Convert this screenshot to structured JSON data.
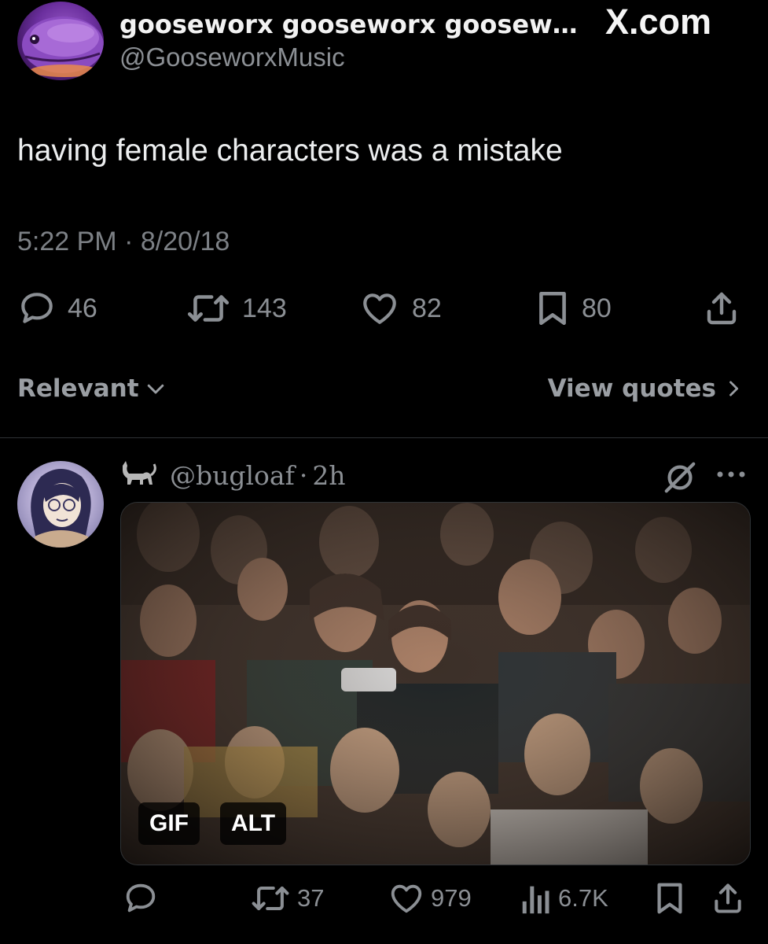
{
  "post": {
    "author_name": "gooseworx gooseworx goosewo...",
    "author_handle": "@GooseworxMusic",
    "site": "X.com",
    "text": "having female characters was a mistake",
    "timestamp": "5:22 PM · 8/20/18",
    "stats": {
      "replies": "46",
      "reposts": "143",
      "likes": "82",
      "bookmarks": "80"
    },
    "sort_label": "Relevant",
    "view_quotes_label": "View quotes"
  },
  "reply": {
    "handle": "@bugloaf",
    "separator": "·",
    "time": "2h",
    "media_badges": {
      "gif": "GIF",
      "alt": "ALT"
    },
    "stats": {
      "replies": "",
      "reposts": "37",
      "likes": "979",
      "views": "6.7K"
    }
  },
  "icons": {
    "reply": "speech-bubble-icon",
    "repost": "repost-arrows-icon",
    "like": "heart-icon",
    "bookmark": "bookmark-icon",
    "share": "share-upload-icon",
    "views": "bar-chart-icon",
    "grok": "grok-slash-icon",
    "more": "more-dots-icon",
    "cat": "cat-emoji-icon",
    "chevron_down": "chevron-down-icon",
    "chevron_right": "chevron-right-icon"
  },
  "colors": {
    "background": "#000000",
    "text_primary": "#e7e9ea",
    "text_secondary": "#8b8f94",
    "divider": "#2f3336"
  }
}
